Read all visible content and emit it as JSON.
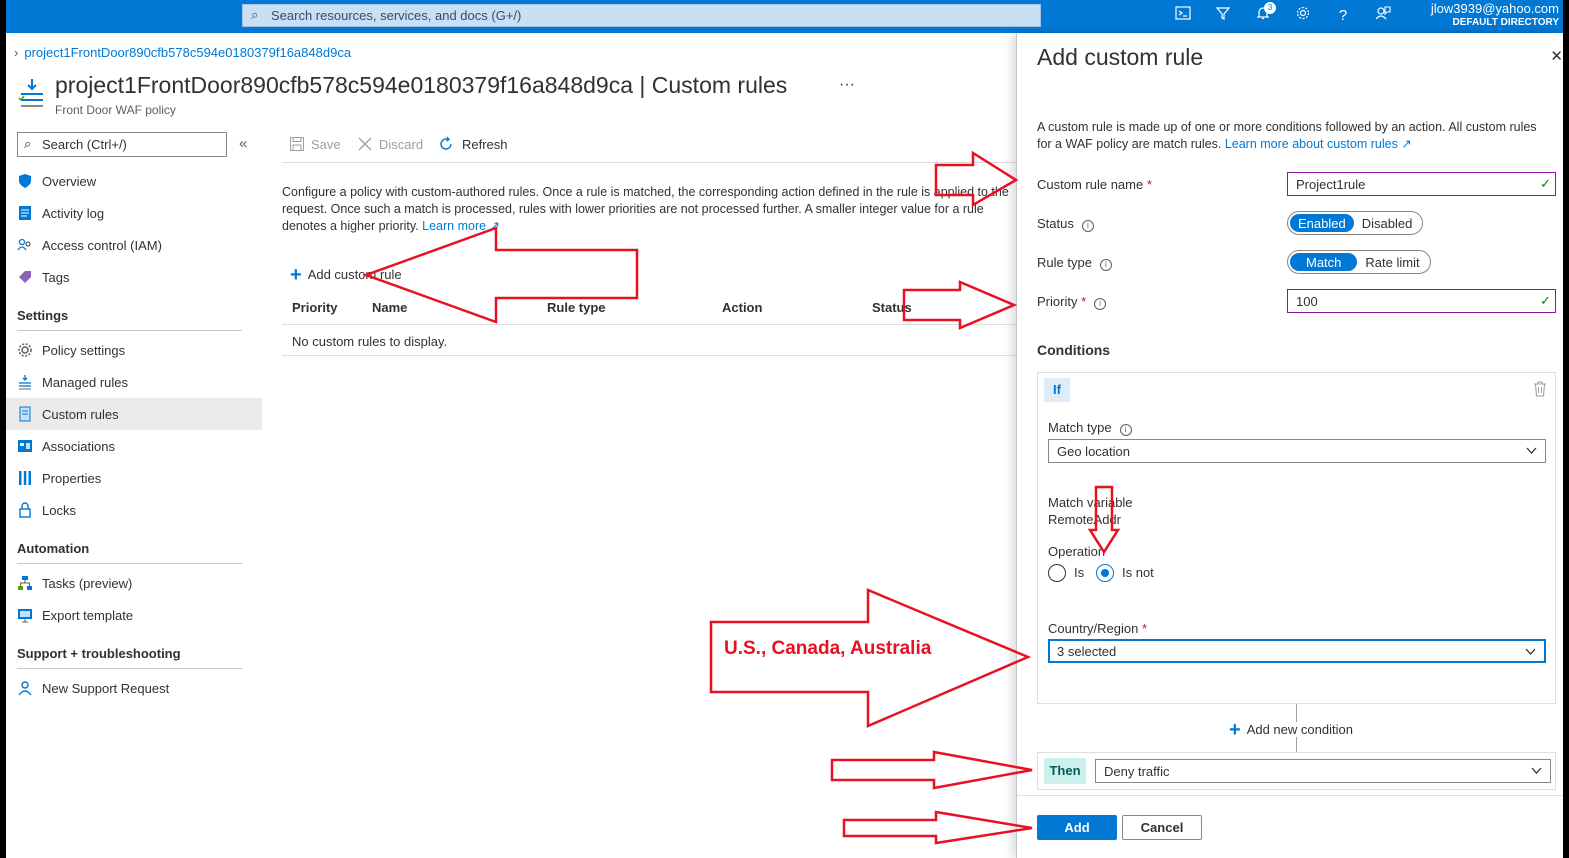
{
  "topbar": {
    "search_placeholder": "Search resources, services, and docs (G+/)",
    "notification_count": "3",
    "user_email": "jlow3939@yahoo.com",
    "user_directory": "DEFAULT DIRECTORY",
    "icons": [
      "cloud-shell-icon",
      "directory-filter-icon",
      "bell-icon",
      "gear-icon",
      "help-icon",
      "feedback-icon"
    ]
  },
  "breadcrumb": {
    "item": "project1FrontDoor890cfb578c594e0180379f16a848d9ca"
  },
  "header": {
    "resource_name": "project1FrontDoor890cfb578c594e0180379f16a848d9ca",
    "separator": "|",
    "blade_name": "Custom rules",
    "more": "···",
    "subtitle": "Front Door WAF policy"
  },
  "nav": {
    "search_placeholder": "Search (Ctrl+/)",
    "collapse": "«",
    "items_top": [
      "Overview",
      "Activity log",
      "Access control (IAM)",
      "Tags"
    ],
    "settings_heading": "Settings",
    "settings_items": [
      "Policy settings",
      "Managed rules",
      "Custom rules",
      "Associations",
      "Properties",
      "Locks"
    ],
    "automation_heading": "Automation",
    "automation_items": [
      "Tasks (preview)",
      "Export template"
    ],
    "support_heading": "Support + troubleshooting",
    "support_items": [
      "New Support Request"
    ],
    "selected": "Custom rules"
  },
  "toolbar": {
    "save": "Save",
    "discard": "Discard",
    "refresh": "Refresh"
  },
  "main": {
    "description": "Configure a policy with custom-authored rules. Once a rule is matched, the corresponding action defined in the rule is applied to the request. Once such a match is processed, rules with lower priorities are not processed further. A smaller integer value for a rule denotes a higher priority.",
    "learn_more": "Learn more",
    "add_custom_rule": "Add custom rule",
    "columns": [
      "Priority",
      "Name",
      "Rule type",
      "Action",
      "Status"
    ],
    "empty_message": "No custom rules to display."
  },
  "panel": {
    "title": "Add custom rule",
    "description": "A custom rule is made up of one or more conditions followed by an action. All custom rules for a WAF policy are match rules.",
    "learn_more": "Learn more about custom rules",
    "rule_name_label": "Custom rule name",
    "rule_name_value": "Project1rule",
    "status_label": "Status",
    "status_options": [
      "Enabled",
      "Disabled"
    ],
    "status_selected": "Enabled",
    "rule_type_label": "Rule type",
    "rule_type_options": [
      "Match",
      "Rate limit"
    ],
    "rule_type_selected": "Match",
    "priority_label": "Priority",
    "priority_value": "100",
    "conditions_heading": "Conditions",
    "if_label": "If",
    "match_type_label": "Match type",
    "match_type_value": "Geo location",
    "match_variable_label": "Match variable",
    "match_variable_value": "RemoteAddr",
    "operation_label": "Operation",
    "operation_options": [
      "Is",
      "Is not"
    ],
    "operation_selected": "Is not",
    "country_label": "Country/Region",
    "country_value": "3 selected",
    "add_condition": "Add new condition",
    "then_label": "Then",
    "then_value": "Deny traffic",
    "add_button": "Add",
    "cancel_button": "Cancel"
  },
  "annotation": {
    "text": "U.S., Canada, Australia",
    "color": "#e81123"
  },
  "colors": {
    "accent": "#0078d4",
    "topbar": "#0078d4",
    "valid_border": "#881798"
  }
}
